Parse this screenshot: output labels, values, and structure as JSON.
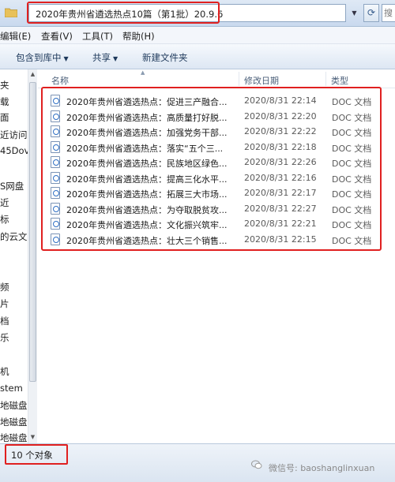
{
  "address_bar": {
    "path": "2020年贵州省遴选热点10篇（第1批）20.9.6",
    "search_text": "搜"
  },
  "menu": [
    "编辑(E)",
    "查看(V)",
    "工具(T)",
    "帮助(H)"
  ],
  "toolbar": {
    "include_library": "包含到库中",
    "share": "共享",
    "new_folder": "新建文件夹"
  },
  "nav": {
    "items": [
      "夹",
      "载",
      "面",
      "近访问",
      "45Dov",
      "S网盘",
      "近",
      "标",
      "的云文",
      "频",
      "片",
      "档",
      "乐",
      "机",
      "stem",
      "地磁盘",
      "地磁盘",
      "地磁盘"
    ]
  },
  "columns": {
    "name": "名称",
    "date": "修改日期",
    "type": "类型"
  },
  "files": [
    {
      "name": "2020年贵州省遴选热点：促进三产融合...",
      "date": "2020/8/31 22:14",
      "type": "DOC 文档"
    },
    {
      "name": "2020年贵州省遴选热点：高质量打好脱...",
      "date": "2020/8/31 22:20",
      "type": "DOC 文档"
    },
    {
      "name": "2020年贵州省遴选热点：加强党务干部...",
      "date": "2020/8/31 22:22",
      "type": "DOC 文档"
    },
    {
      "name": "2020年贵州省遴选热点：落实“五个三...",
      "date": "2020/8/31 22:18",
      "type": "DOC 文档"
    },
    {
      "name": "2020年贵州省遴选热点：民族地区绿色...",
      "date": "2020/8/31 22:26",
      "type": "DOC 文档"
    },
    {
      "name": "2020年贵州省遴选热点：提高三化水平...",
      "date": "2020/8/31 22:16",
      "type": "DOC 文档"
    },
    {
      "name": "2020年贵州省遴选热点：拓展三大市场...",
      "date": "2020/8/31 22:17",
      "type": "DOC 文档"
    },
    {
      "name": "2020年贵州省遴选热点：为夺取脱贫攻...",
      "date": "2020/8/31 22:27",
      "type": "DOC 文档"
    },
    {
      "name": "2020年贵州省遴选热点：文化振兴筑牢...",
      "date": "2020/8/31 22:21",
      "type": "DOC 文档"
    },
    {
      "name": "2020年贵州省遴选热点：壮大三个销售...",
      "date": "2020/8/31 22:15",
      "type": "DOC 文档"
    }
  ],
  "status": {
    "count": "10 个对象"
  },
  "watermark": {
    "text": "微信号: baoshanglinxuan"
  },
  "colors": {
    "highlight": "#e02020",
    "accent": "#2f6fc4"
  }
}
